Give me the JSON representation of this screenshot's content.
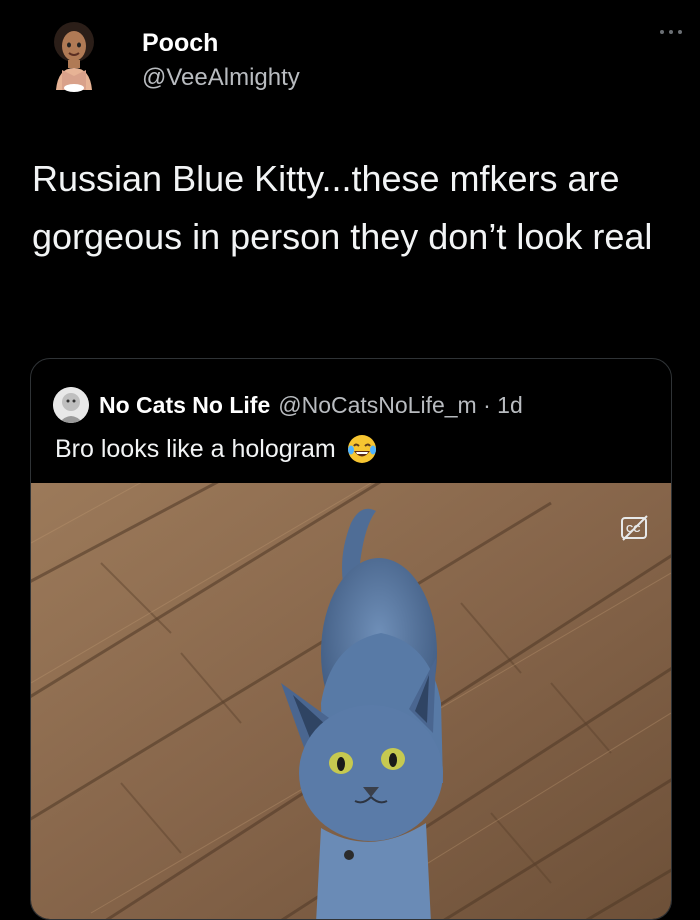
{
  "tweet": {
    "author_name": "Pooch",
    "author_handle": "@VeeAlmighty",
    "text": "Russian Blue Kitty...these mfkers are gorgeous in person they don’t look real",
    "more_icon": "more-dots-icon"
  },
  "quoted": {
    "author_name": "No Cats No Life",
    "meta": "@NoCatsNoLife_m · 1d",
    "text": "Bro looks like a hologram",
    "emoji": "tears-of-joy-emoji",
    "media": {
      "caption_icon": "closed-captions-off-icon"
    }
  }
}
